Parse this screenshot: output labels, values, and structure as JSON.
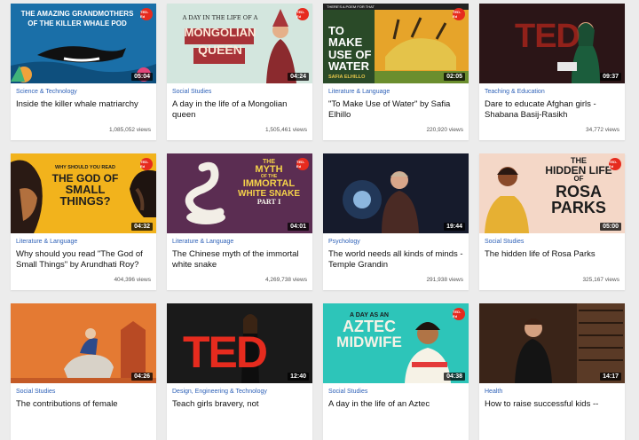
{
  "cards": [
    {
      "category": "Science & Technology",
      "title": "Inside the killer whale matriarchy",
      "views": "1,085,052 views",
      "duration": "05:04",
      "badge": "TED-Ed",
      "thumb_text": [
        "THE AMAZING GRANDMOTHERS",
        "OF THE KILLER WHALE POD"
      ],
      "thumb_bg": "#1d7fb5"
    },
    {
      "category": "Social Studies",
      "title": "A day in the life of a Mongolian queen",
      "views": "1,505,461 views",
      "duration": "04:24",
      "badge": "TED-Ed",
      "thumb_text": [
        "A DAY IN THE LIFE OF A",
        "MONGOLIAN",
        "QUEEN"
      ],
      "thumb_bg": "#cfe3dc"
    },
    {
      "category": "Literature & Language",
      "title": "\"To Make Use of Water\" by Safia Elhillo",
      "views": "220,920 views",
      "duration": "02:05",
      "badge": "TED-Ed",
      "thumb_text": [
        "THERE'S A POEM FOR THAT",
        "TO MAKE",
        "USE OF",
        "WATER",
        "SAFIA ELHILLO"
      ],
      "thumb_bg": "#e9a928"
    },
    {
      "category": "Teaching & Education",
      "title": "Dare to educate Afghan girls - Shabana Basij-Rasikh",
      "views": "34,772 views",
      "duration": "09:37",
      "badge": "",
      "thumb_text": [
        "TED"
      ],
      "thumb_bg": "#2a1618"
    },
    {
      "category": "Literature & Language",
      "title": "Why should you read \"The God of Small Things\" by Arundhati Roy?",
      "views": "404,396 views",
      "duration": "04:32",
      "badge": "TED-Ed",
      "thumb_text": [
        "WHY SHOULD YOU READ",
        "THE GOD OF",
        "SMALL",
        "THINGS?"
      ],
      "thumb_bg": "#f2b21b"
    },
    {
      "category": "Literature & Language",
      "title": "The Chinese myth of the immortal white snake",
      "views": "4,269,738 views",
      "duration": "04:01",
      "badge": "TED-Ed",
      "thumb_text": [
        "THE",
        "MYTH",
        "OF THE",
        "IMMORTAL",
        "WHITE SNAKE",
        "PART I"
      ],
      "thumb_bg": "#5a2d52"
    },
    {
      "category": "Psychology",
      "title": "The world needs all kinds of minds - Temple Grandin",
      "views": "291,938 views",
      "duration": "19:44",
      "badge": "",
      "thumb_text": [],
      "thumb_bg": "#171b2c"
    },
    {
      "category": "Social Studies",
      "title": "The hidden life of Rosa Parks",
      "views": "325,167 views",
      "duration": "05:00",
      "badge": "TED-Ed",
      "thumb_text": [
        "THE",
        "HIDDEN LIFE",
        "OF",
        "ROSA",
        "PARKS"
      ],
      "thumb_bg": "#f3d6c6"
    },
    {
      "category": "Social Studies",
      "title": "The contributions of female",
      "views": "",
      "duration": "04:26",
      "badge": "",
      "thumb_text": [],
      "thumb_bg": "#e27832"
    },
    {
      "category": "Design, Engineering & Technology",
      "title": "Teach girls bravery, not",
      "views": "",
      "duration": "12:40",
      "badge": "",
      "thumb_text": [
        "TED"
      ],
      "thumb_bg": "#1c1c1c"
    },
    {
      "category": "Social Studies",
      "title": "A day in the life of an Aztec",
      "views": "",
      "duration": "04:38",
      "badge": "TED-Ed",
      "thumb_text": [
        "A DAY AS AN",
        "AZTEC",
        "MIDWIFE"
      ],
      "thumb_bg": "#2cc4b8"
    },
    {
      "category": "Health",
      "title": "How to raise successful kids --",
      "views": "",
      "duration": "14:17",
      "badge": "",
      "thumb_text": [],
      "thumb_bg": "#3b2518"
    }
  ]
}
